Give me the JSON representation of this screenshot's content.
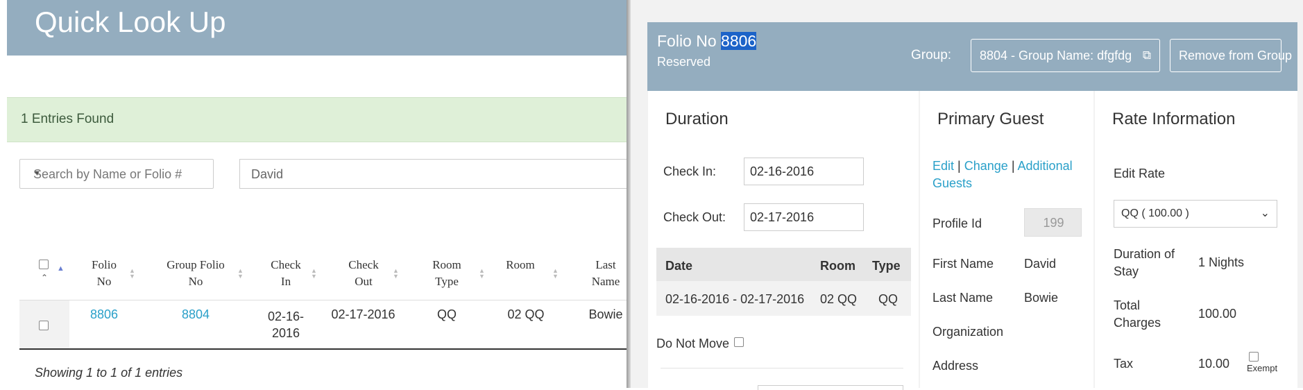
{
  "quick_lookup": {
    "title": "Quick Look Up",
    "entries_found": "1 Entries Found",
    "search_select_placeholder": "Search by Name or Folio #",
    "search_value": "David",
    "columns": [
      {
        "line1": "Folio",
        "line2": "No"
      },
      {
        "line1": "Group  Folio",
        "line2": "No"
      },
      {
        "line1": "Check",
        "line2": "In"
      },
      {
        "line1": "Check",
        "line2": "Out"
      },
      {
        "line1": "Room",
        "line2": "Type"
      },
      {
        "line1": "Room",
        "line2": ""
      },
      {
        "line1": "Last",
        "line2": "Name"
      }
    ],
    "row": {
      "folio_no": "8806",
      "group_folio_no": "8804",
      "check_in_1": "02-16-",
      "check_in_2": "2016",
      "check_out": "02-17-2016",
      "room_type": "QQ",
      "room": "02 QQ",
      "last_name": "Bowie"
    },
    "showing": "Showing 1 to 1 of 1 entries"
  },
  "folio": {
    "title_prefix": "Folio No ",
    "number": "8806",
    "status": "Reserved",
    "group_label": "Group:",
    "group_button": "8804 - Group Name: dfgfdg",
    "remove_button": "Remove from Group"
  },
  "duration": {
    "title": "Duration",
    "check_in_label": "Check In:",
    "check_in_value": "02-16-2016",
    "check_out_label": "Check Out:",
    "check_out_value": "02-17-2016",
    "table_headers": [
      "Date",
      "Room",
      "Type"
    ],
    "table_row": {
      "date": "02-16-2016 - 02-17-2016",
      "room": "02 QQ",
      "type": "QQ"
    },
    "do_not_move": "Do Not Move"
  },
  "primary_guest": {
    "title": "Primary Guest",
    "edit": "Edit",
    "sep": "|",
    "change": "Change",
    "additional": "Additional",
    "guests": "Guests",
    "profile_id_label": "Profile Id",
    "profile_id_value": "199",
    "first_name_label": "First Name",
    "first_name_value": "David",
    "last_name_label": "Last Name",
    "last_name_value": "Bowie",
    "organization_label": "Organization",
    "address_label": "Address"
  },
  "rate": {
    "title": "Rate Information",
    "edit_rate": "Edit Rate",
    "rate_select": "QQ ( 100.00 )",
    "duration_label_1": "Duration of",
    "duration_label_2": "Stay",
    "duration_value": "1 Nights",
    "total_label_1": "Total",
    "total_label_2": "Charges",
    "total_value": "100.00",
    "tax_label": "Tax",
    "tax_value": "10.00",
    "exempt": "Exempt"
  }
}
